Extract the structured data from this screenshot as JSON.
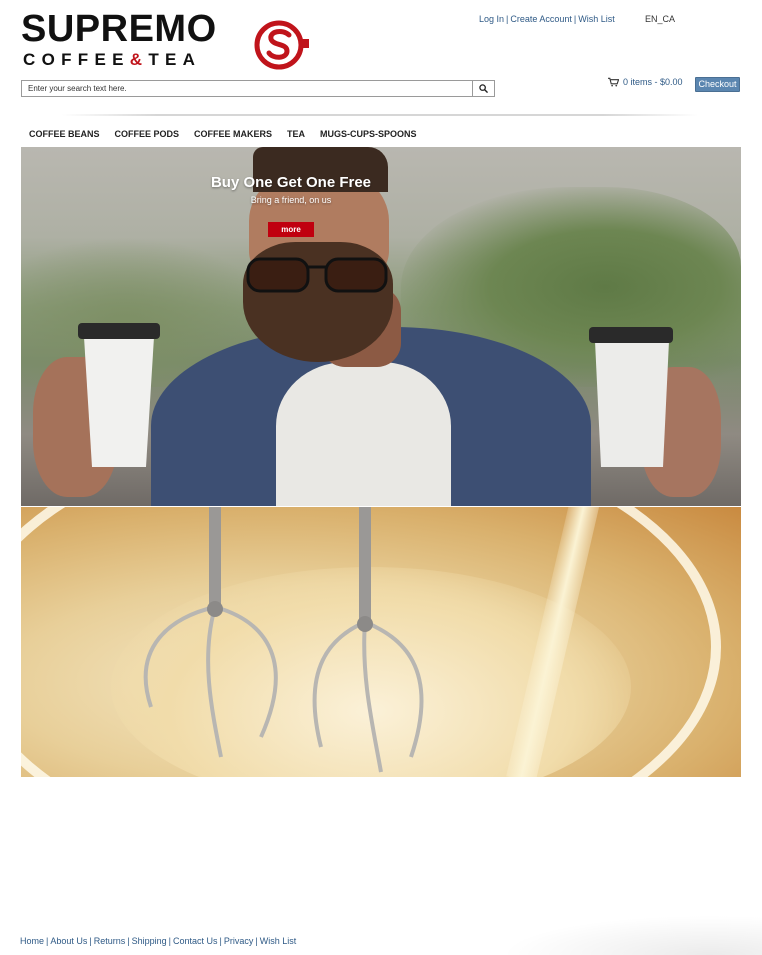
{
  "logo": {
    "line1": "SUPREMO",
    "line2_part1": "COFFEE",
    "line2_amp": "&",
    "line2_part2": "TEA",
    "brand_red": "#c0141b"
  },
  "top_links": [
    {
      "label": "Log In"
    },
    {
      "label": "Create Account"
    },
    {
      "label": "Wish List"
    }
  ],
  "locale": "EN_CA",
  "search": {
    "placeholder": "Enter your search text here.",
    "button_icon": "search-icon"
  },
  "cart": {
    "icon": "cart-icon",
    "summary": "0 items - $0.00",
    "checkout_label": "Checkout"
  },
  "nav": [
    {
      "label": "COFFEE BEANS"
    },
    {
      "label": "COFFEE PODS"
    },
    {
      "label": "COFFEE MAKERS"
    },
    {
      "label": "TEA"
    },
    {
      "label": "MUGS-CUPS-SPOONS"
    }
  ],
  "hero": {
    "title": "Buy One Get One Free",
    "subtitle": "Bring a friend, on us",
    "button": "more",
    "button_color": "#c0000f"
  },
  "footer_links": [
    {
      "label": "Home"
    },
    {
      "label": "About Us"
    },
    {
      "label": "Returns"
    },
    {
      "label": "Shipping"
    },
    {
      "label": "Contact Us"
    },
    {
      "label": "Privacy"
    },
    {
      "label": "Wish List"
    }
  ],
  "colors": {
    "link": "#2f5a86",
    "checkout_bg": "#5b86b0"
  }
}
